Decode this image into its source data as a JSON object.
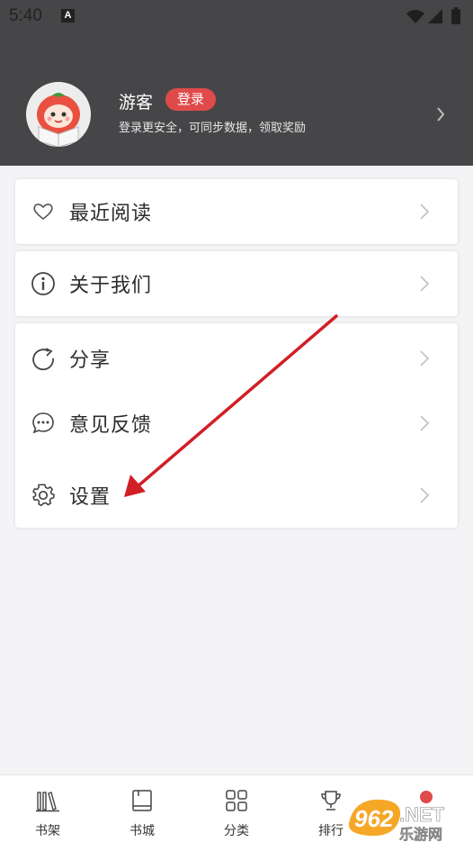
{
  "status_bar": {
    "time": "5:40",
    "indicator": "A"
  },
  "profile": {
    "username": "游客",
    "login_label": "登录",
    "subtitle": "登录更安全，可同步数据，领取奖励",
    "avatar_icon": "tomato-mascot-avatar"
  },
  "menu": {
    "recent": {
      "label": "最近阅读",
      "icon": "heart-icon"
    },
    "about": {
      "label": "关于我们",
      "icon": "info-icon"
    },
    "share": {
      "label": "分享",
      "icon": "share-icon"
    },
    "feedback": {
      "label": "意见反馈",
      "icon": "chat-icon"
    },
    "settings": {
      "label": "设置",
      "icon": "gear-icon"
    }
  },
  "bottom_nav": [
    {
      "label": "书架",
      "icon": "bookshelf-icon"
    },
    {
      "label": "书城",
      "icon": "book-icon"
    },
    {
      "label": "分类",
      "icon": "grid-icon"
    },
    {
      "label": "排行",
      "icon": "trophy-icon"
    }
  ],
  "watermark": {
    "text": "962.NET",
    "sub": "乐游网"
  },
  "colors": {
    "header_bg": "#464649",
    "accent_red": "#e04a4a",
    "page_bg": "#f4f4f6",
    "annotation_arrow": "#d11f26"
  }
}
